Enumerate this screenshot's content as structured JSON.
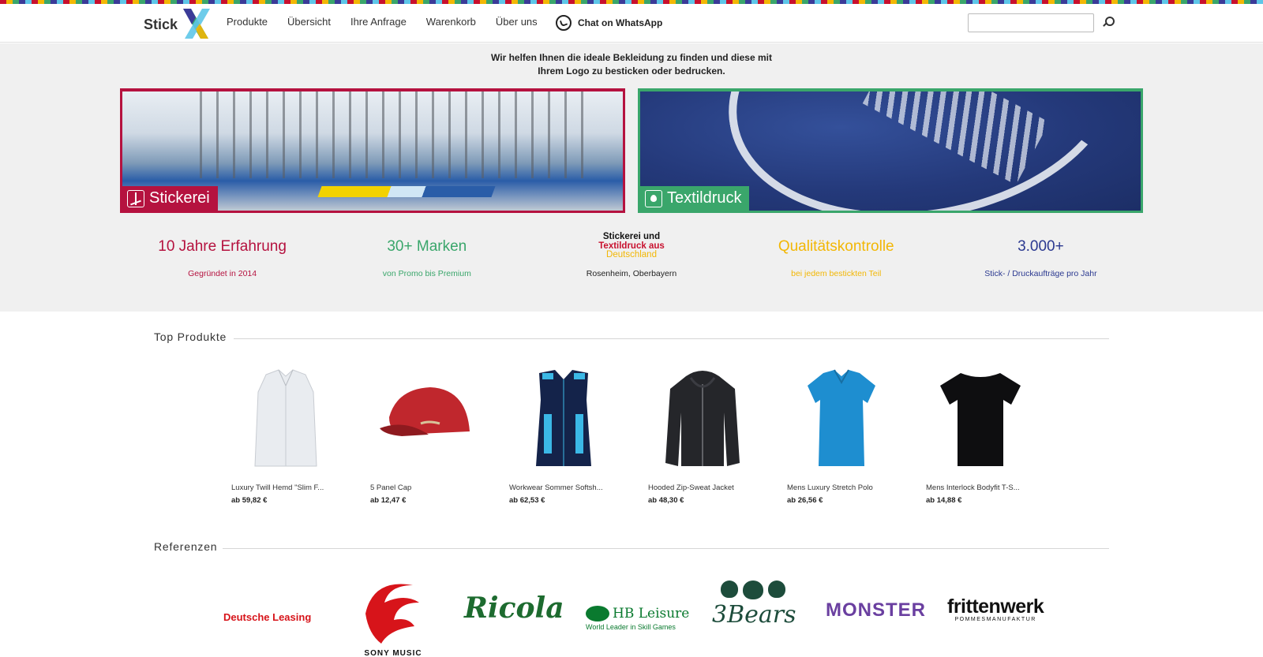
{
  "brand": {
    "logo_text": "Stick"
  },
  "nav": {
    "items": [
      "Produkte",
      "Übersicht",
      "Ihre Anfrage",
      "Warenkorb",
      "Über uns"
    ],
    "whatsapp": "Chat on WhatsApp"
  },
  "search": {
    "placeholder": ""
  },
  "hero": {
    "tagline_1": "Wir helfen Ihnen die ideale Bekleidung zu finden und diese mit",
    "tagline_2": "Ihrem Logo zu besticken oder bedrucken.",
    "cards": {
      "stickerei": "Stickerei",
      "textildruck": "Textildruck"
    },
    "stats": {
      "s1_title": "10 Jahre Erfahrung",
      "s1_sub": "Gegründet in 2014",
      "s2_title": "30+ Marken",
      "s2_sub": "von Promo bis Premium",
      "s3_line1": "Stickerei und",
      "s3_line2": "Textildruck aus",
      "s3_line3": "Deutschland",
      "s3_sub": "Rosenheim, Oberbayern",
      "s4_title": "Qualitätskontrolle",
      "s4_sub": "bei jedem bestickten Teil",
      "s5_title": "3.000+",
      "s5_sub": "Stick- / Druckaufträge pro Jahr"
    }
  },
  "top_products": {
    "title": "Top Produkte",
    "items": [
      {
        "name": "Luxury Twill Hemd \"Slim F...",
        "price": "ab 59,82 €"
      },
      {
        "name": "5 Panel Cap",
        "price": "ab 12,47 €"
      },
      {
        "name": "Workwear Sommer Softsh...",
        "price": "ab 62,53 €"
      },
      {
        "name": "Hooded Zip-Sweat Jacket",
        "price": "ab 48,30 €"
      },
      {
        "name": "Mens Luxury Stretch Polo",
        "price": "ab 26,56 €"
      },
      {
        "name": "Mens Interlock Bodyfit T-S...",
        "price": "ab 14,88 €"
      }
    ]
  },
  "references": {
    "title": "Referenzen",
    "logos": {
      "deutsche_leasing": "Deutsche Leasing",
      "sony_music": "SONY MUSIC",
      "ricola": "Ricola",
      "hb_leisure": "HB Leisure",
      "hb_leisure_sub": "World Leader in Skill Games",
      "three_bears": "3Bears",
      "monster": "MONSTER",
      "frittenwerk": "frittenwerk",
      "frittenwerk_sub": "POMMESMANUFAKTUR"
    }
  },
  "colors": {
    "stickerei": "#b5123f",
    "textildruck": "#3aa66b",
    "yellow": "#f2b705",
    "navy": "#2b3990"
  }
}
